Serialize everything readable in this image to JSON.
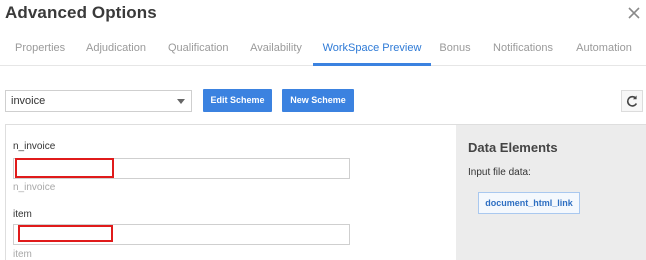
{
  "dialog": {
    "title": "Advanced Options"
  },
  "tabs": [
    {
      "label": "Properties"
    },
    {
      "label": "Adjudication"
    },
    {
      "label": "Qualification"
    },
    {
      "label": "Availability"
    },
    {
      "label": "WorkSpace Preview",
      "active": true
    },
    {
      "label": "Bonus"
    },
    {
      "label": "Notifications"
    },
    {
      "label": "Automation"
    }
  ],
  "toolbar": {
    "scheme_select": {
      "selected": "invoice"
    },
    "edit_scheme_label": "Edit Scheme",
    "new_scheme_label": "New Scheme",
    "refresh_icon": "refresh-icon"
  },
  "form": {
    "fields": [
      {
        "label": "n_invoice",
        "value": "",
        "help": "n_invoice"
      },
      {
        "label": "item",
        "value": "",
        "help": "item"
      }
    ]
  },
  "data_elements": {
    "title": "Data Elements",
    "subtitle": "Input file data:",
    "chips": [
      {
        "label": "document_html_link"
      }
    ]
  },
  "colors": {
    "accent": "#3b82e0",
    "highlight": "#e01b1b",
    "side_panel_bg": "#ececec"
  }
}
